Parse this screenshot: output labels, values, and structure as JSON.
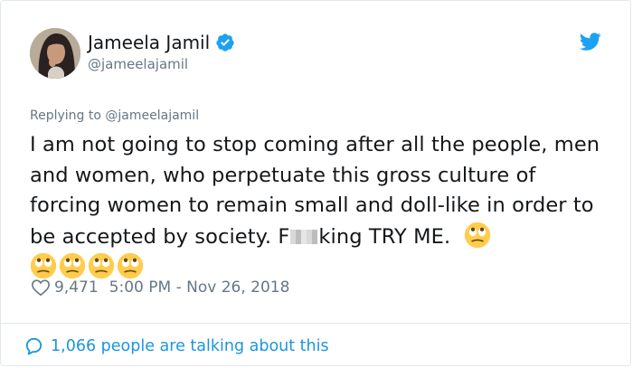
{
  "author": {
    "display_name": "Jameela Jamil",
    "handle": "@jameelajamil",
    "verified": true,
    "avatar_icon": "profile-photo"
  },
  "tweet": {
    "replying_prefix": "Replying to ",
    "replying_handle": "@jameelajamil",
    "text_part1": "I am not going to stop coming after all the people, men and women, who perpetuate this gross culture of forcing women to remain small and doll-like in order to be accepted by society. F",
    "text_part2": "king TRY ME.",
    "emoji_name": "face-with-rolling-eyes",
    "emoji_count": 5
  },
  "meta": {
    "likes": "9,471",
    "timestamp": "5:00 PM - Nov 26, 2018"
  },
  "footer": {
    "talking": "1,066 people are talking about this"
  },
  "colors": {
    "link": "#1b95e0",
    "muted": "#657786",
    "twitter_blue": "#1da1f2",
    "text": "#14171a",
    "border": "#e1e8ed"
  }
}
